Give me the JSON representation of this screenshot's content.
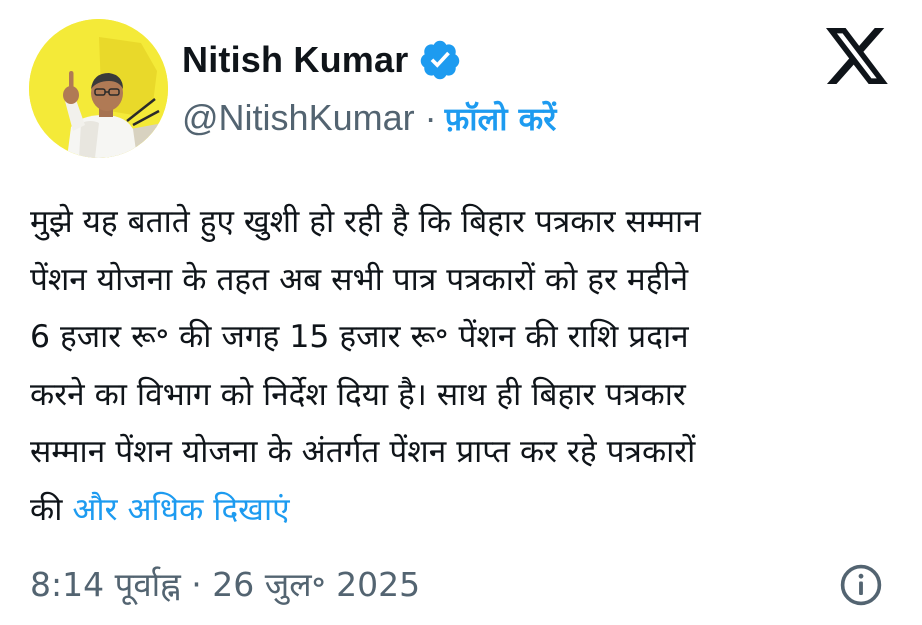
{
  "author": {
    "display_name": "Nitish Kumar",
    "handle": "@NitishKumar",
    "separator": "·",
    "follow_label": "फ़ॉलो करें",
    "verified": true
  },
  "tweet": {
    "lines": [
      "मुझे यह बताते हुए खुशी हो रही है कि बिहार पत्रकार सम्मान",
      "पेंशन योजना के तहत अब सभी पात्र पत्रकारों को हर महीने",
      "6 हजार रू॰ की जगह 15 हजार रू॰ पेंशन की राशि प्रदान",
      "करने का विभाग को निर्देश दिया है। साथ ही बिहार पत्रकार",
      "सम्मान पेंशन योजना के अंतर्गत पेंशन प्राप्त कर रहे पत्रकारों"
    ],
    "last_line_prefix": "की",
    "show_more_label": "और अधिक दिखाएं"
  },
  "footer": {
    "timestamp": "8:14 पूर्वाह्न · 26 जुल॰ 2025"
  },
  "colors": {
    "accent": "#1d9bf0",
    "text_primary": "#0f1419",
    "text_secondary": "#536471",
    "avatar_background": "#f4ea38"
  },
  "icons": {
    "verified": "verified-badge-icon",
    "brand": "x-logo-icon",
    "info": "info-icon"
  }
}
